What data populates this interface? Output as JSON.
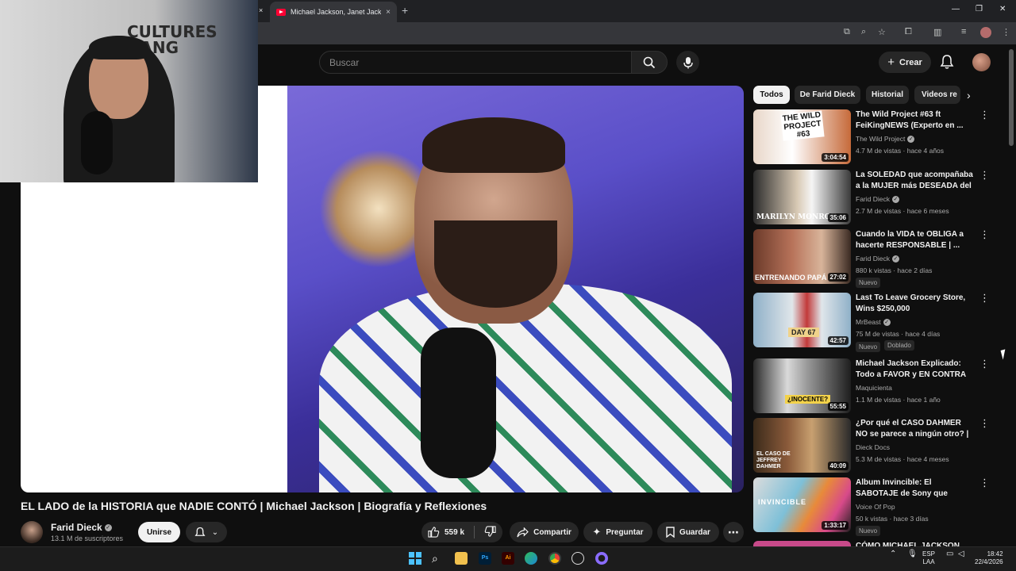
{
  "browser": {
    "tab_title": "Michael Jackson, Janet Jackson",
    "tab_close": "×",
    "new_tab": "+",
    "webcam_close": "×",
    "window_minimize": "—",
    "window_restore": "❐",
    "window_close": "✕"
  },
  "header": {
    "search_placeholder": "Buscar",
    "create_label": "Crear"
  },
  "webcam": {
    "sign_line1": "CULTURES",
    "sign_line2": "GANG"
  },
  "video": {
    "title": "EL LADO de la HISTORIA que NADIE CONTÓ | Michael Jackson | Biografía y Reflexiones",
    "channel": "Farid Dieck",
    "subscribers": "13.1 M de suscriptores",
    "join_label": "Unirse",
    "likes": "559 k",
    "share_label": "Compartir",
    "ask_label": "Preguntar",
    "save_label": "Guardar"
  },
  "chips": [
    "Todos",
    "De Farid Dieck",
    "Historial",
    "Videos re"
  ],
  "recommendations": [
    {
      "title": "The Wild Project #63 ft FeiKingNEWS (Experto en ...",
      "channel": "The Wild Project",
      "verified": true,
      "meta": "4.7 M de vistas · hace 4 años",
      "duration": "3:04:54",
      "badges": []
    },
    {
      "title": "La SOLEDAD que acompañaba a la MUJER más DESEADA del ...",
      "channel": "Farid Dieck",
      "verified": true,
      "meta": "2.7 M de vistas · hace 6 meses",
      "duration": "35:06",
      "badges": []
    },
    {
      "title": "Cuando la VIDA te OBLIGA a hacerte RESPONSABLE | ...",
      "channel": "Farid Dieck",
      "verified": true,
      "meta": "880 k vistas · hace 2 días",
      "duration": "27:02",
      "badges": [
        "Nuevo"
      ]
    },
    {
      "title": "Last To Leave Grocery Store, Wins $250,000",
      "channel": "MrBeast",
      "verified": true,
      "meta": "75 M de vistas · hace 4 días",
      "duration": "42:57",
      "badges": [
        "Nuevo",
        "Doblado"
      ]
    },
    {
      "title": "Michael Jackson Explicado: Todo a FAVOR y EN CONTRA d...",
      "channel": "Maquicienta",
      "verified": false,
      "meta": "1.1 M de vistas · hace 1 año",
      "duration": "55:55",
      "badges": []
    },
    {
      "title": "¿Por qué el CASO DAHMER NO se parece a ningún otro? | ...",
      "channel": "Dieck Docs",
      "verified": false,
      "meta": "5.3 M de vistas · hace 4 meses",
      "duration": "40:09",
      "badges": []
    },
    {
      "title": "Album Invincible: El SABOTAJE de Sony que ARRUINÓ a ...",
      "channel": "Voice Of Pop",
      "verified": false,
      "meta": "50 k vistas · hace 3 días",
      "duration": "1:33:17",
      "badges": [
        "Nuevo"
      ]
    },
    {
      "title": "CÓMO MICHAEL JACKSON",
      "channel": "",
      "verified": false,
      "meta": "",
      "duration": "",
      "badges": []
    }
  ],
  "thumb_texts": {
    "t1": "THE WILD PROJECT #63",
    "t2": "MARILYN MONROE",
    "t3": "ENTRENANDO PAPÁ",
    "t4": "DAY 67",
    "t5": "¿INOCENTE?",
    "t6": "EL CASO DE JEFFREY DAHMER",
    "t7": "INVINCIBLE"
  },
  "taskbar": {
    "lang1": "ESP",
    "lang2": "LAA",
    "time": "18:42",
    "date": "22/4/2026"
  },
  "colors": {
    "background": "#0f0f0f",
    "accent": "#ff0033",
    "chip_active": "#f1f1f1",
    "chip": "#272727"
  }
}
